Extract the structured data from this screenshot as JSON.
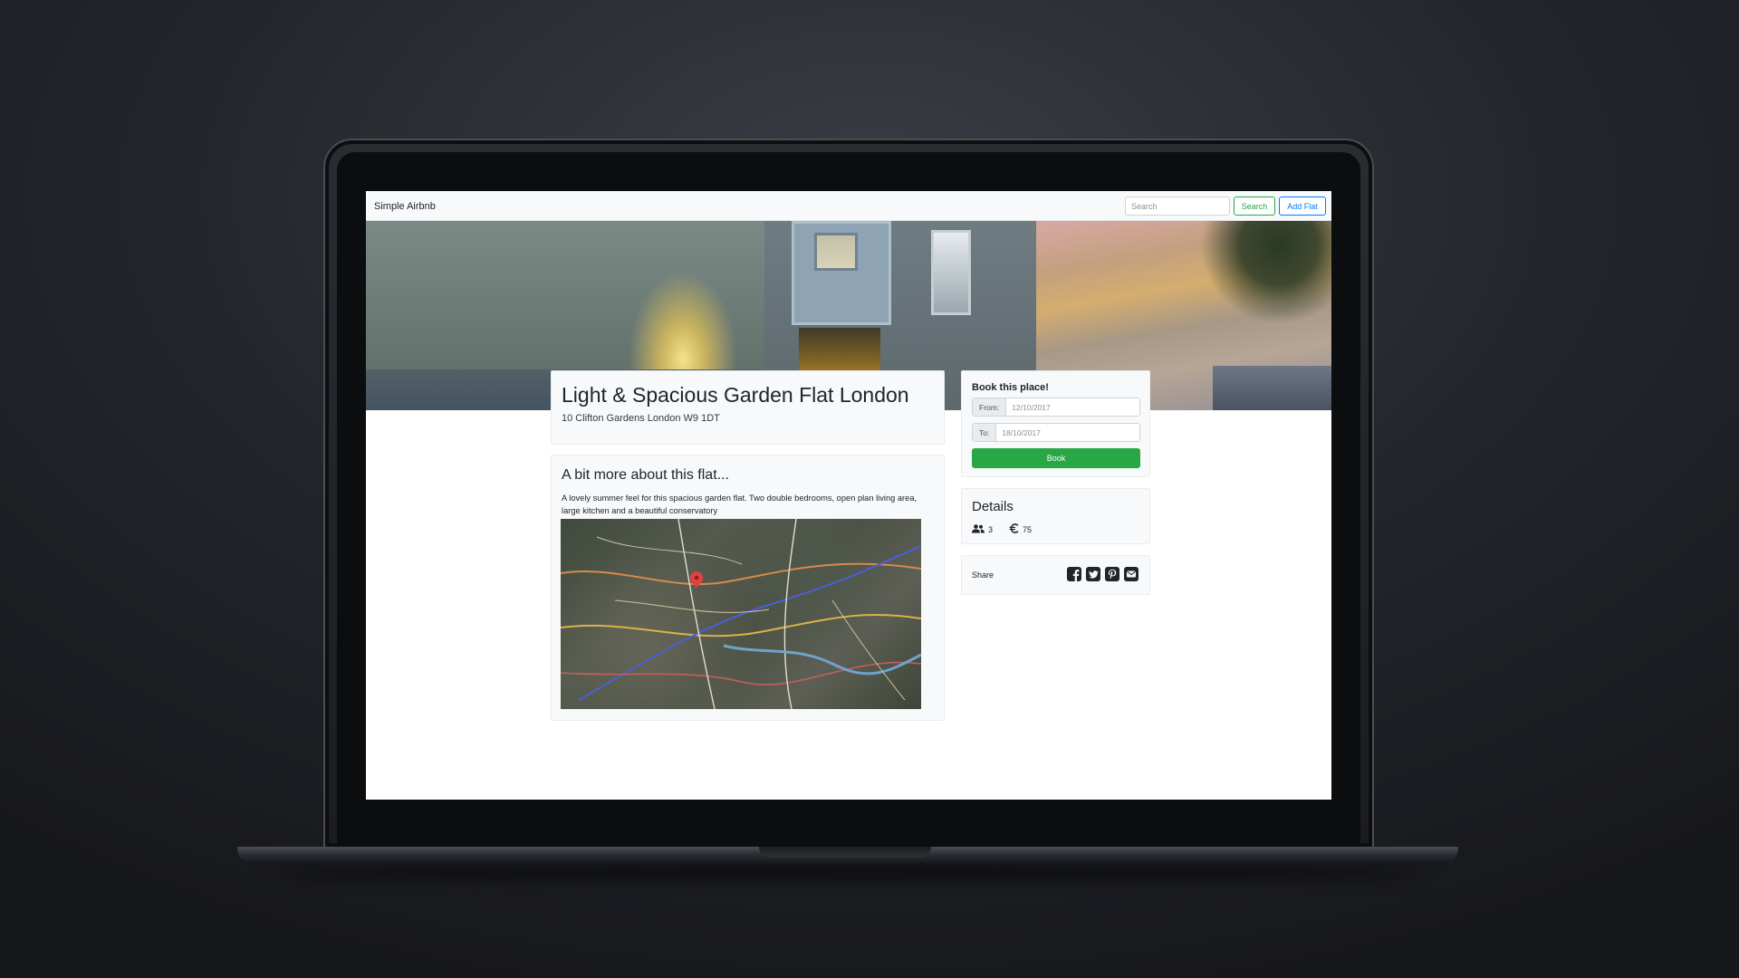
{
  "navbar": {
    "brand": "Simple Airbnb",
    "search_placeholder": "Search",
    "search_button": "Search",
    "add_flat_button": "Add Flat"
  },
  "listing": {
    "title": "Light & Spacious Garden Flat London",
    "address": "10 Clifton Gardens London W9 1DT"
  },
  "about": {
    "heading": "A bit more about this flat...",
    "description": "A lovely summer feel for this spacious garden flat. Two double bedrooms, open plan living area, large kitchen and a beautiful conservatory"
  },
  "booking": {
    "heading": "Book this place!",
    "from_label": "From:",
    "from_placeholder": "12/10/2017",
    "to_label": "To:",
    "to_placeholder": "18/10/2017",
    "book_button": "Book"
  },
  "details": {
    "heading": "Details",
    "guests": "3",
    "price": "75",
    "guests_icon": "users-icon",
    "price_icon": "euro-icon"
  },
  "share": {
    "label": "Share",
    "icons": [
      "facebook-icon",
      "twitter-icon",
      "pinterest-icon",
      "envelope-icon"
    ]
  },
  "colors": {
    "success": "#28a745",
    "primary": "#007bff",
    "navbar_bg": "#f8f9fa"
  }
}
